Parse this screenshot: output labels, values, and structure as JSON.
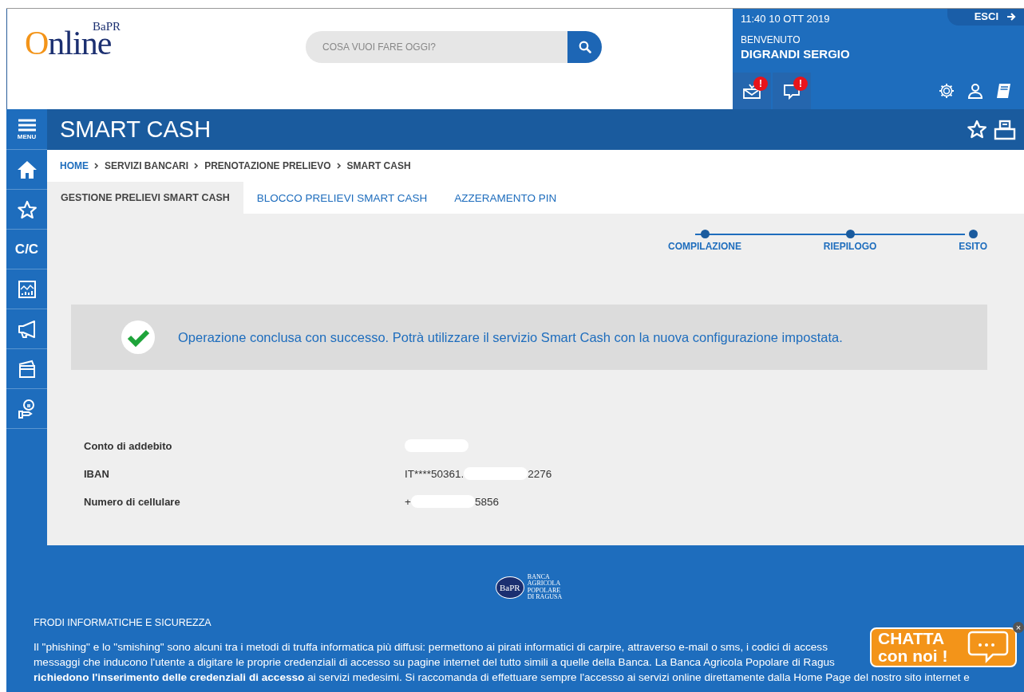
{
  "header": {
    "logo": {
      "word": "Online",
      "mark": "BaPR"
    },
    "search": {
      "placeholder": "COSA VUOI FARE OGGI?"
    },
    "user_panel": {
      "last_access": "11:40   10 OTT 2019",
      "logout": "ESCI",
      "welcome": "BENVENUTO",
      "user_name": "DIGRANDI SERGIO",
      "alerts": [
        {
          "badge": "!"
        },
        {
          "badge": "!"
        }
      ]
    }
  },
  "sidebar": {
    "menu_label": "MENU",
    "items": [
      {
        "kind": "icon"
      },
      {
        "kind": "icon"
      },
      {
        "kind": "text",
        "label": "C/C"
      },
      {
        "kind": "icon"
      },
      {
        "kind": "icon"
      },
      {
        "kind": "icon"
      },
      {
        "kind": "icon"
      }
    ]
  },
  "page_title": "SMART CASH",
  "breadcrumb": [
    {
      "label": "HOME",
      "link": true
    },
    {
      "label": "SERVIZI BANCARI",
      "link": false
    },
    {
      "label": "PRENOTAZIONE PRELIEVO",
      "link": false
    },
    {
      "label": "SMART CASH",
      "link": false
    }
  ],
  "tabs": [
    {
      "label": "GESTIONE PRELIEVI SMART CASH",
      "selected": true
    },
    {
      "label": "BLOCCO PRELIEVI SMART CASH",
      "selected": false
    },
    {
      "label": "AZZERAMENTO PIN",
      "selected": false
    }
  ],
  "steps": [
    {
      "label": "COMPILAZIONE"
    },
    {
      "label": "RIEPILOGO"
    },
    {
      "label": "ESITO"
    }
  ],
  "result": {
    "message": "Operazione conclusa con successo. Potrà utilizzare il servizio Smart Cash con la nuova configurazione impostata."
  },
  "details": [
    {
      "label": "Conto di addebito",
      "value": [
        {
          "kind": "redacted"
        }
      ]
    },
    {
      "label": "IBAN",
      "value": [
        {
          "kind": "text",
          "text": "IT****50361."
        },
        {
          "kind": "redacted"
        },
        {
          "kind": "text",
          "text": "2276"
        }
      ]
    },
    {
      "label": "Numero di cellulare",
      "value": [
        {
          "kind": "text",
          "text": "+"
        },
        {
          "kind": "redacted"
        },
        {
          "kind": "text",
          "text": "5856"
        }
      ]
    }
  ],
  "footer": {
    "seal_mark": "BaPR",
    "bank_name": [
      "BANCA",
      "AGRICOLA",
      "POPOLARE",
      "DI RAGUSA"
    ],
    "heading": "FRODI INFORMATICHE E SICUREZZA",
    "lines": [
      "Il \"phishing\" e lo \"smishing\" sono alcuni tra i metodi di truffa informatica più diffusi: permettono ai pirati informatici di carpire, attraverso e-mail o sms, i codici di access",
      "messaggi che inducono l'utente a digitare le proprie credenziali di accesso su pagine internet del tutto simili a quelle della Banca. La Banca Agricola Popolare di Ragus",
      "**richiedono l'inserimento delle credenziali di accesso** ai servizi medesimi. Si raccomanda di effettuare sempre l'accesso ai servizi online direttamente dalla Home Page del nostro sito internet e"
    ]
  },
  "chat": {
    "line_1": "CHATTA",
    "line_2": "con noi !",
    "close": "×"
  }
}
